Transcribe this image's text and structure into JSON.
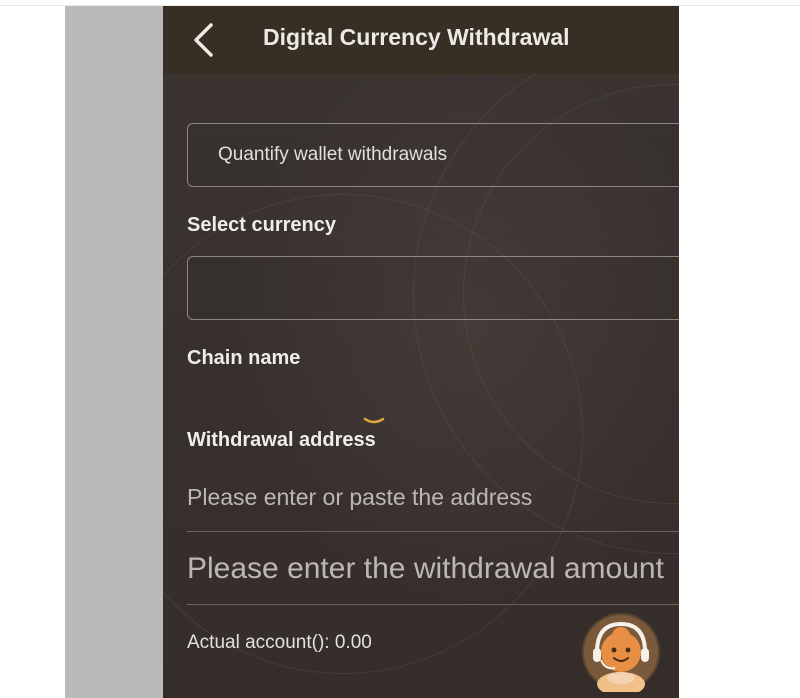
{
  "header": {
    "title": "Digital Currency Withdrawal",
    "back_icon": "chevron-left-icon"
  },
  "wallet_select": {
    "value": "Quantify wallet withdrawals"
  },
  "currency": {
    "label": "Select currency",
    "value": ""
  },
  "chain": {
    "label": "Chain name"
  },
  "address": {
    "label": "Withdrawal address",
    "placeholder": "Please enter or paste the address"
  },
  "amount": {
    "placeholder": "Please enter the withdrawal amount"
  },
  "actual_account": {
    "label": "Actual account():",
    "value": "0.00"
  },
  "support": {
    "icon": "customer-service-avatar-icon"
  },
  "colors": {
    "background": "#3b3330",
    "header": "#372f23",
    "accent": "#e3a63a"
  }
}
